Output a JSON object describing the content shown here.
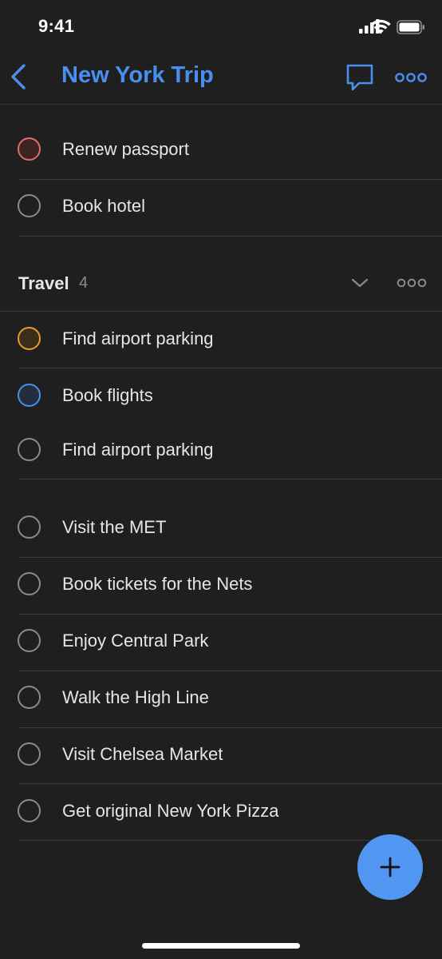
{
  "status_bar": {
    "time": "9:41",
    "icons": [
      "cellular-signal-icon",
      "wifi-icon",
      "battery-icon"
    ]
  },
  "nav": {
    "title": "New York Trip",
    "accent_color": "#4a8ef0",
    "back_icon": "chevron-left-icon",
    "comment_icon": "chat-bubble-icon",
    "more_icon": "more-horizontal-icon"
  },
  "tasks_top": [
    {
      "label": "Renew passport",
      "priority_color": "#e06c6c"
    },
    {
      "label": "Book hotel",
      "priority_color": "#8a8a8a"
    }
  ],
  "section": {
    "title": "Travel",
    "count": "4",
    "chevron_icon": "chevron-down-icon",
    "more_icon": "more-horizontal-icon",
    "tasks": [
      {
        "label": "Find airport parking",
        "priority_color": "#e89a2c"
      },
      {
        "label": "Book flights",
        "priority_color": "#4a8ef0"
      },
      {
        "label": "Find airport parking",
        "priority_color": "#8a8a8a"
      }
    ]
  },
  "tasks_bottom": [
    {
      "label": "Visit the MET"
    },
    {
      "label": "Book tickets for the Nets"
    },
    {
      "label": "Enjoy Central Park"
    },
    {
      "label": "Walk the High Line"
    },
    {
      "label": "Visit Chelsea Market"
    },
    {
      "label": "Get original New York Pizza"
    }
  ],
  "fab": {
    "icon": "plus-icon",
    "color": "#5196f0"
  },
  "colors": {
    "background": "#1f1f1f",
    "divider": "#3a3a3a",
    "text": "#e6e6e6",
    "muted": "#8c8c8c"
  }
}
